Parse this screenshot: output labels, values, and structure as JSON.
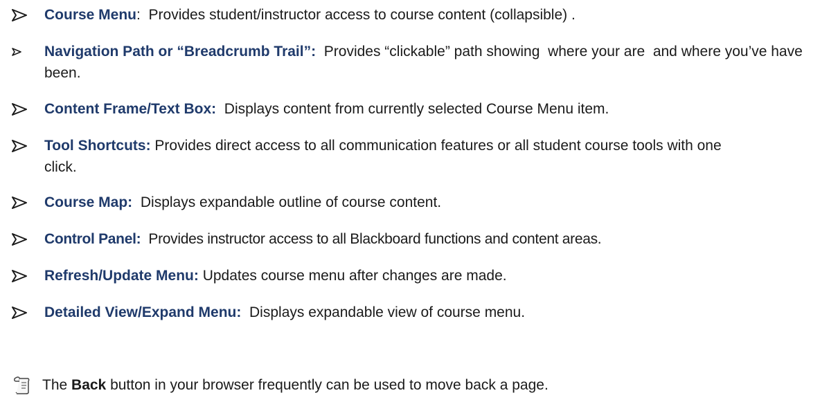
{
  "items": [
    {
      "term": "Course Menu",
      "sep": ":",
      "desc": "  Provides student/instructor access to course content (collapsible) ."
    },
    {
      "term": "Navigation Path or “Breadcrumb Trail”:",
      "sep": "",
      "desc": "  Provides “clickable” path showing  where your are  and where you’ve have been."
    },
    {
      "term": "Content Frame/Text Box:",
      "sep": "",
      "desc": "  Displays content from currently selected Course Menu item."
    },
    {
      "term": "Tool Shortcuts:",
      "sep": "",
      "desc": " Provides direct access to all communication features or all student course tools with one click."
    },
    {
      "term": "Course Map:",
      "sep": "",
      "desc": "  Displays expandable outline of course content."
    },
    {
      "term": "Control Panel:",
      "sep": "",
      "desc": "  Provides instructor access to all Blackboard functions and content areas."
    },
    {
      "term": "Refresh/Update Menu:",
      "sep": "",
      "desc": " Updates course menu after changes are made."
    },
    {
      "term": "Detailed View/Expand Menu:",
      "sep": "",
      "desc": "  Displays expandable view of course menu."
    }
  ],
  "note": {
    "pre": "The ",
    "bold": "Back",
    "post": " button in your browser frequently can be used to move back a page.",
    "icon": "note-paper-icon"
  },
  "colors": {
    "term": "#1f3a6b",
    "text": "#1a1a1a"
  }
}
